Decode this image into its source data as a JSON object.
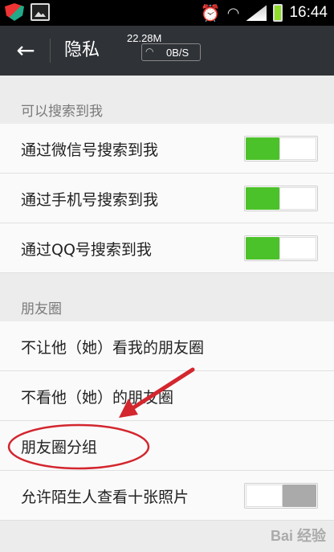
{
  "status_bar": {
    "time": "16:44",
    "icons": [
      "shield-icon",
      "picture-icon",
      "alarm-icon",
      "wifi-icon",
      "signal-icon",
      "battery-icon"
    ]
  },
  "top_bar": {
    "title": "隐私",
    "back_icon": "arrow-left-icon",
    "net_total": "22.28M",
    "net_rate": "0B/S"
  },
  "sections": [
    {
      "header": "可以搜索到我",
      "items": [
        {
          "label": "通过微信号搜索到我",
          "toggle": true
        },
        {
          "label": "通过手机号搜索到我",
          "toggle": true
        },
        {
          "label": "通过QQ号搜索到我",
          "toggle": true
        }
      ]
    },
    {
      "header": "朋友圈",
      "items": [
        {
          "label": "不让他（她）看我的朋友圈"
        },
        {
          "label": "不看他（她）的朋友圈"
        },
        {
          "label": "朋友圈分组"
        },
        {
          "label": "允许陌生人查看十张照片",
          "toggle": false
        }
      ]
    }
  ],
  "colors": {
    "toggle_on": "#4cc22a",
    "toggle_off": "#aaaaaa",
    "annotation": "#d3262e",
    "topbar": "#2f3236"
  },
  "watermark": "Bai 经验"
}
